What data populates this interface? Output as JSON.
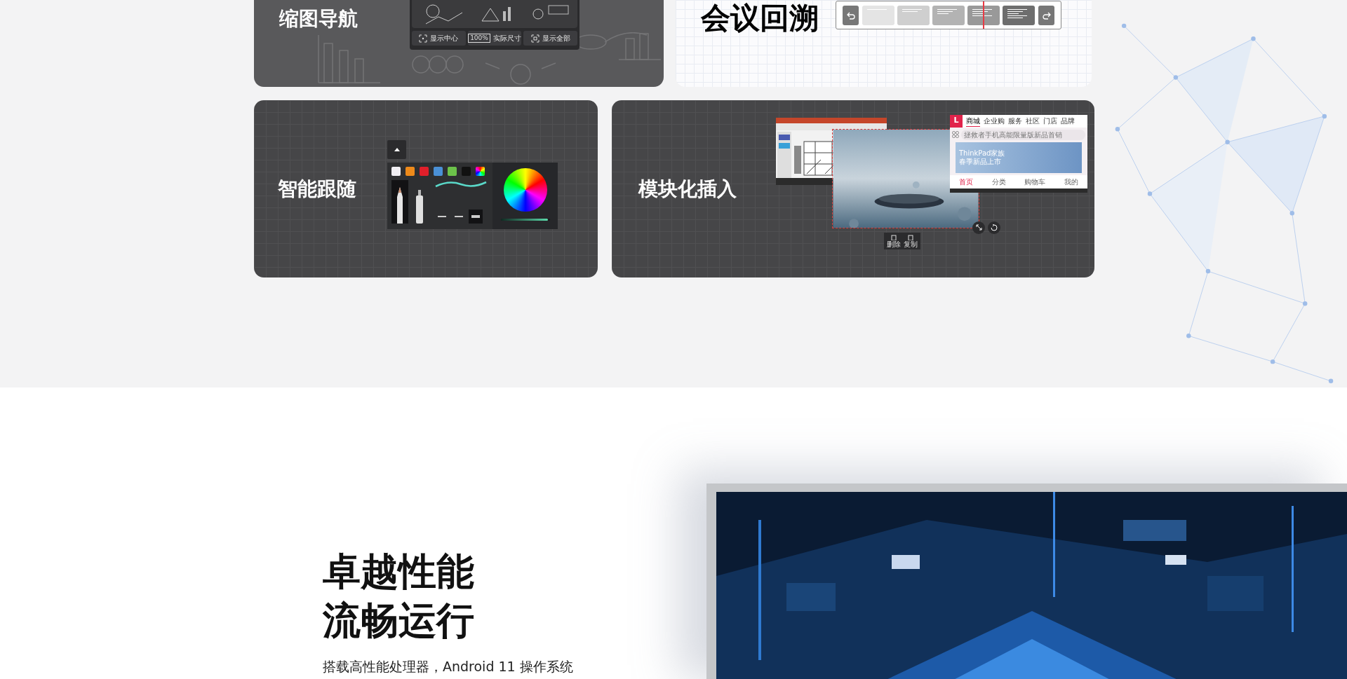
{
  "features": [
    {
      "kind": "thumbnail_nav",
      "title": "缩图导航",
      "buttons": [
        {
          "label": "显示中心"
        },
        {
          "label": "实际尺寸",
          "icon_text": "100%"
        },
        {
          "label": "显示全部"
        }
      ]
    },
    {
      "kind": "timeline",
      "title": "会议回溯",
      "playhead": {
        "level": 0.7
      }
    },
    {
      "kind": "palette",
      "title": "智能跟随",
      "swatches": [
        {
          "kind": "solid",
          "color": "#f0eef3"
        },
        {
          "kind": "solid",
          "color": "#ee8a1a"
        },
        {
          "kind": "solid",
          "color": "#e01f2a"
        },
        {
          "kind": "solid",
          "color": "#4a90d6"
        },
        {
          "kind": "solid",
          "color": "#6cc24a"
        },
        {
          "kind": "solid",
          "color": "#111111"
        },
        {
          "kind": "rainbow"
        }
      ],
      "tools": [
        {
          "kind": "pencil",
          "selected": true
        },
        {
          "kind": "marker",
          "selected": false
        }
      ],
      "widths": [
        {
          "selected": false
        },
        {
          "selected": false
        },
        {
          "selected": true
        }
      ],
      "brightness": {
        "level": 0.97
      }
    },
    {
      "kind": "modules",
      "title": "模块化插入",
      "store": {
        "logo": "L",
        "tabs": [
          {
            "label": "商城",
            "selected": true
          },
          {
            "label": "企业购",
            "selected": false
          },
          {
            "label": "服务",
            "selected": false
          },
          {
            "label": "社区",
            "selected": false
          },
          {
            "label": "门店",
            "selected": false
          },
          {
            "label": "品牌",
            "selected": false
          }
        ],
        "search_placeholder": "拯救者手机高能限量版新品首销",
        "banner": [
          "ThinkPad家族",
          "春季新品上市"
        ],
        "nav": [
          {
            "label": "首页",
            "selected": true
          },
          {
            "label": "分类",
            "selected": false
          },
          {
            "label": "购物车",
            "selected": false
          },
          {
            "label": "我的",
            "selected": false
          }
        ]
      },
      "actions": [
        "删除",
        "复制"
      ]
    }
  ],
  "performance": {
    "title_lines": [
      "卓越性能",
      "流畅运行"
    ],
    "description": "搭载高性能处理器，Android 11 操作系统"
  }
}
